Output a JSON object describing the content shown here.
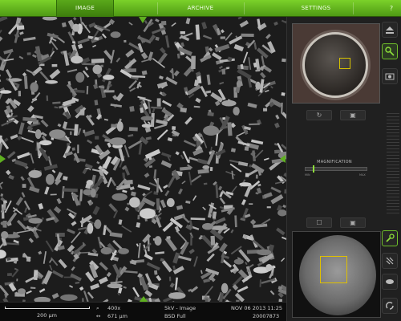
{
  "tabs": [
    {
      "label": "IMAGE",
      "active": true
    },
    {
      "label": "ARCHIVE",
      "active": false
    },
    {
      "label": "SETTINGS",
      "active": false
    }
  ],
  "help_label": "?",
  "status": {
    "scale_label": "200 µm",
    "magnification": "400x",
    "field_width": "671 µm",
    "voltage_mode": "5kV - Image",
    "detector": "BSD Full",
    "datetime": "NOV 06 2013 11:25",
    "image_id": "20007873"
  },
  "panel": {
    "magnification_title": "MAGNIFICATION",
    "magnification_min": "MIN",
    "magnification_max": "MAX",
    "magnification_level": 0.12
  },
  "colors": {
    "accent": "#6fbf2a",
    "tab_bar": "#5faa1e",
    "frame_box": "#e0c000"
  },
  "icons": {
    "eject": "eject-icon",
    "navigate": "navigation-icon",
    "camera": "camera-icon",
    "focus": "wrench-icon",
    "scan": "scan-icon",
    "detector": "detector-icon",
    "brightness": "contrast-icon"
  }
}
